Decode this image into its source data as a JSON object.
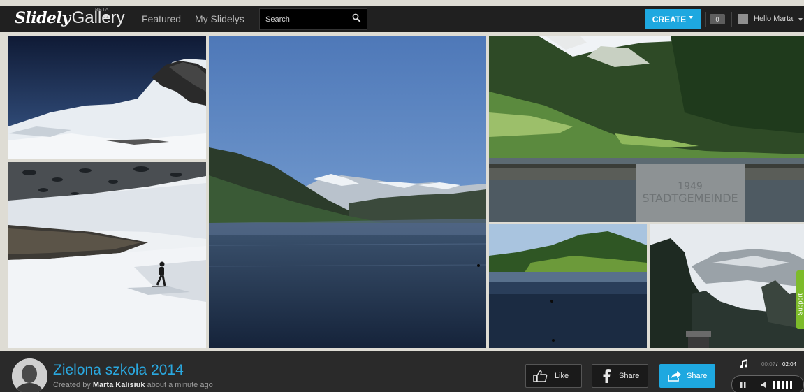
{
  "header": {
    "logo_main": "Slidely",
    "logo_gallery": "Gallery",
    "logo_badge": "BETA",
    "nav": [
      {
        "label": "Featured"
      },
      {
        "label": "My Slidelys"
      }
    ],
    "search": {
      "placeholder": "Search",
      "value": ""
    },
    "create_label": "CREATE",
    "notifications_count": "0",
    "user_greeting": "Hello Marta"
  },
  "support_label": "Support",
  "slideshow": {
    "title": "Zielona szkoła 2014",
    "created_prefix": "Created by",
    "author": "Marta Kalisiuk",
    "created_suffix": "about a minute ago"
  },
  "actions": {
    "like_label": "Like",
    "facebook_share_label": "Share",
    "share_label": "Share"
  },
  "player": {
    "time_current": "00:07",
    "time_separator": "/",
    "time_total": "02:04"
  },
  "colors": {
    "accent": "#1ea8e0",
    "support": "#7dbb2a",
    "bar": "#202020"
  },
  "icons": [
    "search-icon",
    "caret-down-icon",
    "thumbs-up-icon",
    "facebook-icon",
    "share-arrow-icon",
    "music-note-icon",
    "pause-icon",
    "volume-icon"
  ]
}
